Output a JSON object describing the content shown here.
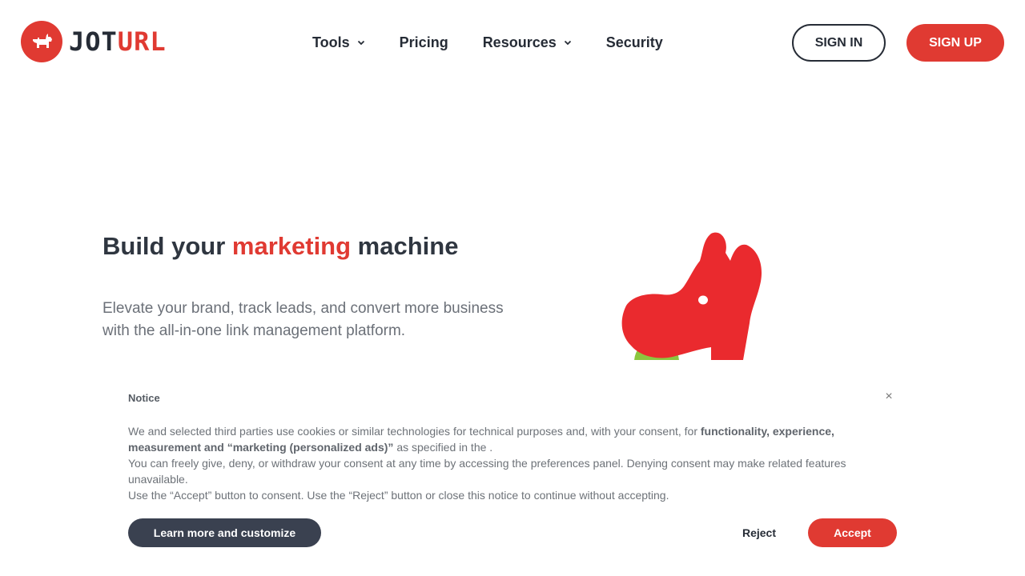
{
  "brand": {
    "logo_icon": "dog-icon",
    "name_part1": "JOT",
    "name_part2": "URL",
    "accent_color": "#e03a32",
    "dark_color": "#262c36"
  },
  "nav": {
    "items": [
      {
        "label": "Tools",
        "has_dropdown": true
      },
      {
        "label": "Pricing",
        "has_dropdown": false
      },
      {
        "label": "Resources",
        "has_dropdown": true
      },
      {
        "label": "Security",
        "has_dropdown": false
      }
    ],
    "signin_label": "SIGN IN",
    "signup_label": "SIGN UP"
  },
  "hero": {
    "title_before": "Build your ",
    "title_accent": "marketing",
    "title_after": " machine",
    "subtitle": "Elevate your brand, track leads, and convert more business with the all-in-one link management platform.",
    "illustration": "dog-mascot-illustration"
  },
  "notice": {
    "title": "Notice",
    "close_icon": "close-icon",
    "line1_text": "We and selected third parties use cookies or similar technologies for technical purposes and, with your consent, for ",
    "line1_bold": "functionality, experience, measurement and “marketing (personalized ads)”",
    "line1_tail": " as specified in the .",
    "line2": "You can freely give, deny, or withdraw your consent at any time by accessing the preferences panel. Denying consent may make related features unavailable.",
    "line3": "Use the “Accept” button to consent. Use the “Reject” button or close this notice to continue without accepting.",
    "learn_label": "Learn more and customize",
    "reject_label": "Reject",
    "accept_label": "Accept"
  }
}
